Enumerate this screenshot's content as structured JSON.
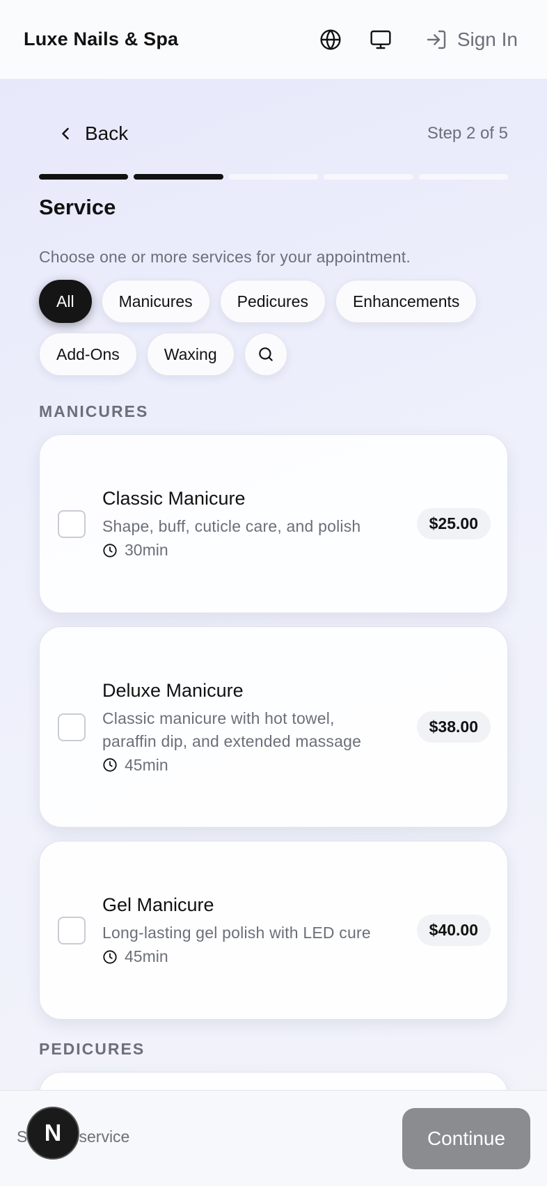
{
  "header": {
    "brand": "Luxe Nails & Spa",
    "sign_in": "Sign In"
  },
  "nav": {
    "back": "Back",
    "step": "Step 2 of 5",
    "progress": {
      "completed": 2,
      "total": 5
    }
  },
  "page": {
    "title": "Service",
    "subtitle": "Choose one or more services for your appointment."
  },
  "filters": {
    "chips": [
      "All",
      "Manicures",
      "Pedicures",
      "Enhancements",
      "Add-Ons",
      "Waxing"
    ],
    "active": "All"
  },
  "sections": {
    "manicures": {
      "label": "MANICURES",
      "services": [
        {
          "name": "Classic Manicure",
          "desc_lines": [
            "Shape, buff, cuticle care, and polish"
          ],
          "duration": "30min",
          "price": "$25.00",
          "selected": false
        },
        {
          "name": "Deluxe Manicure",
          "desc_lines": [
            "Classic manicure with hot towel,",
            "paraffin dip, and extended massage"
          ],
          "duration": "45min",
          "price": "$38.00",
          "selected": false
        },
        {
          "name": "Gel Manicure",
          "desc_lines": [
            "Long-lasting gel polish with LED cure"
          ],
          "duration": "45min",
          "price": "$40.00",
          "selected": false
        }
      ]
    },
    "pedicures": {
      "label": "PEDICURES"
    }
  },
  "footer": {
    "status": "Select a service",
    "continue": "Continue",
    "badge": "N"
  },
  "colors": {
    "accent": "#111111",
    "muted_text": "#6b6f78",
    "continue_disabled": "#8b8c8f"
  }
}
